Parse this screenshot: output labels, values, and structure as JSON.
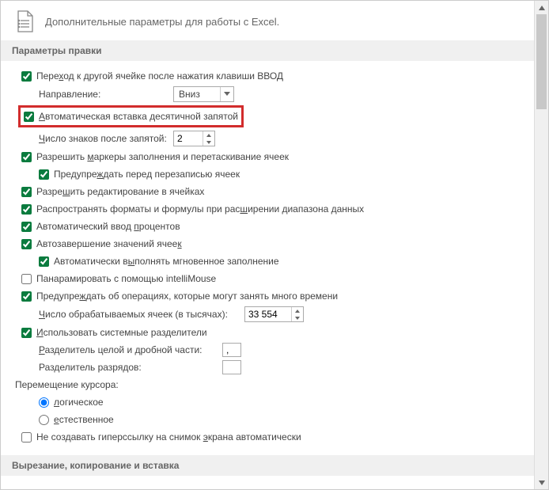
{
  "header": {
    "title": "Дополнительные параметры для работы с Excel."
  },
  "sections": {
    "editing_header": "Параметры правки",
    "cut_copy_header": "Вырезание, копирование и вставка"
  },
  "fields": {
    "move_after_enter": "Переход к другой ячейке после нажатия клавиши ВВОД",
    "direction_label": "Направление:",
    "direction_value": "Вниз",
    "auto_decimal": "Автоматическая вставка десятичной запятой",
    "decimal_digits_label": "Число знаков после запятой:",
    "decimal_digits_value": "2",
    "fill_handle": "Разрешить маркеры заполнения и перетаскивание ячеек",
    "warn_overwrite": "Предупреждать перед перезаписью ячеек",
    "edit_in_cell": "Разрешить редактирование в ячейках",
    "extend_formats": "Распространять форматы и формулы при расширении диапазона данных",
    "auto_percent": "Автоматический ввод процентов",
    "autocomplete": "Автозавершение значений ячеек",
    "flash_fill": "Автоматически выполнять мгновенное заполнение",
    "intellimouse": "Панарамировать с помощью intelliMouse",
    "warn_long_ops": "Предупреждать об операциях, которые могут занять много времени",
    "cells_thousands_label": "Число обрабатываемых ячеек (в тысячах):",
    "cells_thousands_value": "33 554",
    "use_sys_separators": "Использовать системные разделители",
    "decimal_sep_label": "Разделитель целой и дробной части:",
    "decimal_sep_value": ",",
    "thousand_sep_label": "Разделитель разрядов:",
    "thousand_sep_value": "",
    "cursor_move_header": "Перемещение курсора:",
    "cursor_logical": "логическое",
    "cursor_natural": "естественное",
    "no_hyperlink_screenshot": "Не создавать гиперссылку на снимок экрана автоматически"
  }
}
